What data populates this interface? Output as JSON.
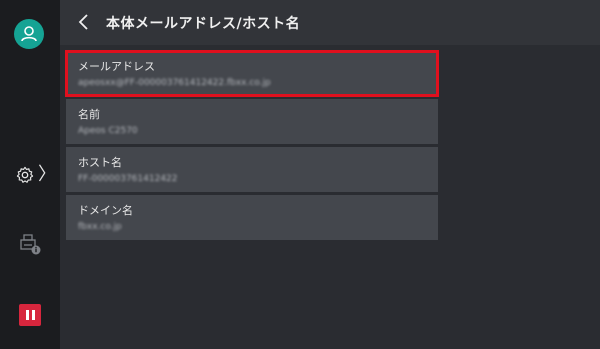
{
  "sidebar": {
    "icons": {
      "user": "user-icon",
      "settings": "gear-icon",
      "printer": "printer-info-icon",
      "stop": "pause-icon"
    },
    "chevron": "〉"
  },
  "header": {
    "title": "本体メールアドレス/ホスト名"
  },
  "items": [
    {
      "label": "メールアドレス",
      "value": "apeosxx@FF-000003761412422.fbxx.co.jp"
    },
    {
      "label": "名前",
      "value": "Apeos C2570"
    },
    {
      "label": "ホスト名",
      "value": "FF-000003761412422"
    },
    {
      "label": "ドメイン名",
      "value": "fbxx.co.jp"
    }
  ],
  "colors": {
    "accent": "#15a394",
    "highlight": "#e0101e",
    "stop": "#d7263d"
  }
}
